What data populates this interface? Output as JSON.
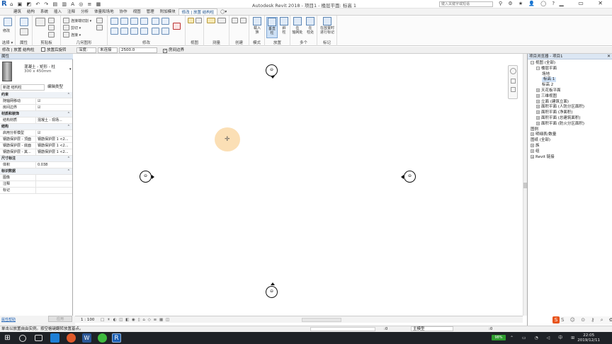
{
  "app": {
    "logo": "R",
    "title": "Autodesk Revit 2018 -   项目1 - 楼层平面: 标高 1",
    "search_placeholder": "键入关键字或短语",
    "qat_icons": "⌂ ▣ ◩ ↶ ↷ ▤ ▥ A ◎ ≡ ▦",
    "title_icons": "⚲ ⚙ ★ 👤 ◯ ?",
    "window_controls": "▁ ▭ ✕"
  },
  "tabs": [
    "建筑",
    "结构",
    "系统",
    "插入",
    "注释",
    "分析",
    "体量和场地",
    "协作",
    "视图",
    "管理",
    "附加模块",
    "修改 | 放置 结构柱",
    "◯▾"
  ],
  "ribbon": {
    "groups": [
      {
        "label": "选择 ▾"
      },
      {
        "label": "属性"
      },
      {
        "label": "剪贴板"
      },
      {
        "label": "几何图形"
      },
      {
        "label": "修改"
      },
      {
        "label": "视图"
      },
      {
        "label": "测量"
      },
      {
        "label": "创建"
      },
      {
        "label": "模式"
      },
      {
        "label": "放置"
      },
      {
        "label": "多个"
      },
      {
        "label": "标记"
      }
    ],
    "modify_label": "修改",
    "clipboard_items": [
      "连接端切割 ▾",
      "剪切 ▾",
      "连接 ▾"
    ],
    "mode_button": "载入\n族",
    "place_vertical": "垂直\n柱",
    "place_slanted": "斜\n柱",
    "multi_grid": "在\n轴网处",
    "multi_column": "在\n柱处",
    "tag_button": "在放置时\n进行标记"
  },
  "options_bar": {
    "context": "修改 | 放置 结构柱",
    "rotate_after": "放置后旋转",
    "depth_mode": "深度:",
    "level": "未连接",
    "height": "2500.0",
    "room_bounding": "房间边界"
  },
  "properties": {
    "header": "属性",
    "family_name": "混凝土 - 矩形 - 柱",
    "type_name": "300 x 450mm",
    "selector": "新建 结构柱",
    "edit_type": "编辑类型",
    "sections": [
      {
        "title": "约束",
        "rows": [
          {
            "k": "随轴网移动",
            "v": "☑"
          },
          {
            "k": "房间边界",
            "v": "☑"
          }
        ]
      },
      {
        "title": "材质和装饰",
        "rows": [
          {
            "k": "结构材质",
            "v": "混凝土 - 现场..."
          }
        ]
      },
      {
        "title": "结构",
        "rows": [
          {
            "k": "启用分析模型",
            "v": "☑"
          },
          {
            "k": "钢筋保护层 - 顶面",
            "v": "钢筋保护层 1 <2..."
          },
          {
            "k": "钢筋保护层 - 底面",
            "v": "钢筋保护层 1 <2..."
          },
          {
            "k": "钢筋保护层 - 其...",
            "v": "钢筋保护层 1 <2..."
          }
        ]
      },
      {
        "title": "尺寸标注",
        "rows": [
          {
            "k": "体积",
            "v": "0.038"
          }
        ]
      },
      {
        "title": "标识数据",
        "rows": [
          {
            "k": "图像",
            "v": ""
          },
          {
            "k": "注释",
            "v": ""
          },
          {
            "k": "标记",
            "v": ""
          }
        ]
      }
    ],
    "help_link": "属性帮助",
    "apply": "应用"
  },
  "project_browser": {
    "header": "项目浏览器 - 项目1",
    "nodes": [
      {
        "label": "视图 (全部)",
        "depth": 0,
        "tog": "−"
      },
      {
        "label": "楼层平面",
        "depth": 1,
        "tog": "−"
      },
      {
        "label": "场地",
        "depth": 2,
        "tog": ""
      },
      {
        "label": "标高 1",
        "depth": 2,
        "tog": "",
        "selected": true
      },
      {
        "label": "标高 2",
        "depth": 2,
        "tog": ""
      },
      {
        "label": "天花板平面",
        "depth": 1,
        "tog": "+"
      },
      {
        "label": "三维视图",
        "depth": 1,
        "tog": "+"
      },
      {
        "label": "立面 (建筑立面)",
        "depth": 1,
        "tog": "+"
      },
      {
        "label": "面积平面 (人防分区面积)",
        "depth": 1,
        "tog": "+"
      },
      {
        "label": "面积平面 (净面积)",
        "depth": 1,
        "tog": "+"
      },
      {
        "label": "面积平面 (总建筑面积)",
        "depth": 1,
        "tog": "+"
      },
      {
        "label": "面积平面 (防火分区面积)",
        "depth": 1,
        "tog": "+"
      },
      {
        "label": "图例",
        "depth": 0,
        "tog": ""
      },
      {
        "label": "明细表/数量",
        "depth": 0,
        "tog": "+"
      },
      {
        "label": "图纸 (全部)",
        "depth": 0,
        "tog": ""
      },
      {
        "label": "族",
        "depth": 0,
        "tog": "+"
      },
      {
        "label": "组",
        "depth": 0,
        "tog": "+"
      },
      {
        "label": "Revit 链接",
        "depth": 0,
        "tog": "∞"
      }
    ]
  },
  "canvas": {
    "elevation_markers": [
      "⊖",
      "⊖",
      "⊖",
      "⊖"
    ]
  },
  "view_control": {
    "scale": "1 : 100",
    "icons": "□ ☀ ◐ ◫ ◧ ◉ ▯ ⌂ ◇ ≡ ▦ ◫"
  },
  "status": {
    "message": "单击以放置自由实例。按空格键翻转放置基点。",
    "zero1": ":0",
    "model": "主模型",
    "zero2": ":0"
  },
  "taskbar": {
    "battery": "98%",
    "time": "22:05",
    "date": "2019/12/11",
    "tray": "⌃ ▭ ◔ ◁ 中 ⊞"
  },
  "sohu": "S ☺ ⊙ ⚷ ⌕ ✿ ⊡"
}
